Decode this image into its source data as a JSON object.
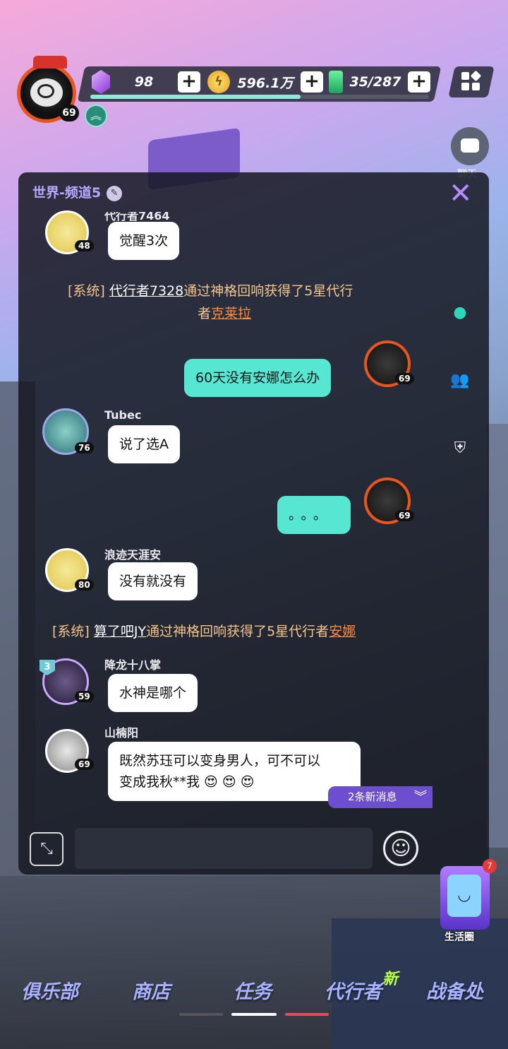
{
  "hud": {
    "player_level": "69",
    "gems": "98",
    "coins": "596.1万",
    "stamina": "35/287",
    "xp_progress": 0.62,
    "side_chat_label": "聊天"
  },
  "chat": {
    "channel_title": "世界-频道5",
    "messages": [
      {
        "kind": "other",
        "name": "代行者7464",
        "level": "48",
        "text": "觉醒3次"
      },
      {
        "kind": "system",
        "prefix": "[系统]",
        "user": "代行者7328",
        "mid": "通过神格回响获得了5星代行",
        "mid2": "者",
        "hero": "克莱拉"
      },
      {
        "kind": "mine",
        "level": "69",
        "text": "60天没有安娜怎么办"
      },
      {
        "kind": "other",
        "name": "Tubec",
        "level": "76",
        "text": "说了选A"
      },
      {
        "kind": "mine",
        "level": "69",
        "text": "。。。"
      },
      {
        "kind": "other",
        "name": "浪迹天涯安",
        "level": "80",
        "text": "没有就没有"
      },
      {
        "kind": "system",
        "prefix": "[系统]",
        "user": "算了吧JY",
        "mid": "通过神格回响获得了5星代行者",
        "hero": "安娜"
      },
      {
        "kind": "other",
        "name": "降龙十八掌",
        "level": "59",
        "rank": "3",
        "text": "水神是哪个"
      },
      {
        "kind": "other",
        "name": "山楠阳",
        "level": "69",
        "text_line1": "既然苏珏可以变身男人，可不可以",
        "text_line2": "变成我秋**我 😍 😍 😍"
      }
    ],
    "new_messages": "2条新消息",
    "input_placeholder": ""
  },
  "life_circle": {
    "label": "生活圈",
    "badge": "7"
  },
  "nav": {
    "items": [
      "俱乐部",
      "商店",
      "任务",
      "代行者",
      "战备处"
    ],
    "new_tag": "新"
  },
  "colors": {
    "accent": "#56e6d2",
    "channel": "#b9a6ff",
    "system": "#f5c58b",
    "hero": "#ff8a3a"
  }
}
